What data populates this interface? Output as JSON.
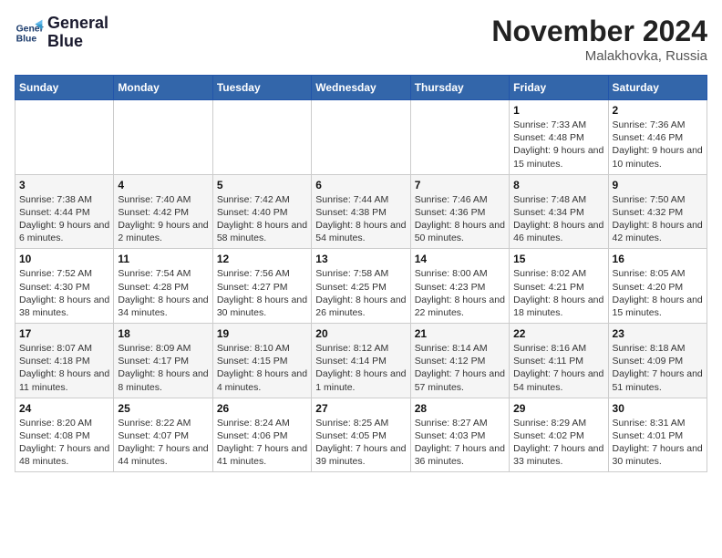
{
  "header": {
    "logo_line1": "General",
    "logo_line2": "Blue",
    "month": "November 2024",
    "location": "Malakhovka, Russia"
  },
  "weekdays": [
    "Sunday",
    "Monday",
    "Tuesday",
    "Wednesday",
    "Thursday",
    "Friday",
    "Saturday"
  ],
  "weeks": [
    [
      {
        "day": "",
        "info": ""
      },
      {
        "day": "",
        "info": ""
      },
      {
        "day": "",
        "info": ""
      },
      {
        "day": "",
        "info": ""
      },
      {
        "day": "",
        "info": ""
      },
      {
        "day": "1",
        "info": "Sunrise: 7:33 AM\nSunset: 4:48 PM\nDaylight: 9 hours and 15 minutes."
      },
      {
        "day": "2",
        "info": "Sunrise: 7:36 AM\nSunset: 4:46 PM\nDaylight: 9 hours and 10 minutes."
      }
    ],
    [
      {
        "day": "3",
        "info": "Sunrise: 7:38 AM\nSunset: 4:44 PM\nDaylight: 9 hours and 6 minutes."
      },
      {
        "day": "4",
        "info": "Sunrise: 7:40 AM\nSunset: 4:42 PM\nDaylight: 9 hours and 2 minutes."
      },
      {
        "day": "5",
        "info": "Sunrise: 7:42 AM\nSunset: 4:40 PM\nDaylight: 8 hours and 58 minutes."
      },
      {
        "day": "6",
        "info": "Sunrise: 7:44 AM\nSunset: 4:38 PM\nDaylight: 8 hours and 54 minutes."
      },
      {
        "day": "7",
        "info": "Sunrise: 7:46 AM\nSunset: 4:36 PM\nDaylight: 8 hours and 50 minutes."
      },
      {
        "day": "8",
        "info": "Sunrise: 7:48 AM\nSunset: 4:34 PM\nDaylight: 8 hours and 46 minutes."
      },
      {
        "day": "9",
        "info": "Sunrise: 7:50 AM\nSunset: 4:32 PM\nDaylight: 8 hours and 42 minutes."
      }
    ],
    [
      {
        "day": "10",
        "info": "Sunrise: 7:52 AM\nSunset: 4:30 PM\nDaylight: 8 hours and 38 minutes."
      },
      {
        "day": "11",
        "info": "Sunrise: 7:54 AM\nSunset: 4:28 PM\nDaylight: 8 hours and 34 minutes."
      },
      {
        "day": "12",
        "info": "Sunrise: 7:56 AM\nSunset: 4:27 PM\nDaylight: 8 hours and 30 minutes."
      },
      {
        "day": "13",
        "info": "Sunrise: 7:58 AM\nSunset: 4:25 PM\nDaylight: 8 hours and 26 minutes."
      },
      {
        "day": "14",
        "info": "Sunrise: 8:00 AM\nSunset: 4:23 PM\nDaylight: 8 hours and 22 minutes."
      },
      {
        "day": "15",
        "info": "Sunrise: 8:02 AM\nSunset: 4:21 PM\nDaylight: 8 hours and 18 minutes."
      },
      {
        "day": "16",
        "info": "Sunrise: 8:05 AM\nSunset: 4:20 PM\nDaylight: 8 hours and 15 minutes."
      }
    ],
    [
      {
        "day": "17",
        "info": "Sunrise: 8:07 AM\nSunset: 4:18 PM\nDaylight: 8 hours and 11 minutes."
      },
      {
        "day": "18",
        "info": "Sunrise: 8:09 AM\nSunset: 4:17 PM\nDaylight: 8 hours and 8 minutes."
      },
      {
        "day": "19",
        "info": "Sunrise: 8:10 AM\nSunset: 4:15 PM\nDaylight: 8 hours and 4 minutes."
      },
      {
        "day": "20",
        "info": "Sunrise: 8:12 AM\nSunset: 4:14 PM\nDaylight: 8 hours and 1 minute."
      },
      {
        "day": "21",
        "info": "Sunrise: 8:14 AM\nSunset: 4:12 PM\nDaylight: 7 hours and 57 minutes."
      },
      {
        "day": "22",
        "info": "Sunrise: 8:16 AM\nSunset: 4:11 PM\nDaylight: 7 hours and 54 minutes."
      },
      {
        "day": "23",
        "info": "Sunrise: 8:18 AM\nSunset: 4:09 PM\nDaylight: 7 hours and 51 minutes."
      }
    ],
    [
      {
        "day": "24",
        "info": "Sunrise: 8:20 AM\nSunset: 4:08 PM\nDaylight: 7 hours and 48 minutes."
      },
      {
        "day": "25",
        "info": "Sunrise: 8:22 AM\nSunset: 4:07 PM\nDaylight: 7 hours and 44 minutes."
      },
      {
        "day": "26",
        "info": "Sunrise: 8:24 AM\nSunset: 4:06 PM\nDaylight: 7 hours and 41 minutes."
      },
      {
        "day": "27",
        "info": "Sunrise: 8:25 AM\nSunset: 4:05 PM\nDaylight: 7 hours and 39 minutes."
      },
      {
        "day": "28",
        "info": "Sunrise: 8:27 AM\nSunset: 4:03 PM\nDaylight: 7 hours and 36 minutes."
      },
      {
        "day": "29",
        "info": "Sunrise: 8:29 AM\nSunset: 4:02 PM\nDaylight: 7 hours and 33 minutes."
      },
      {
        "day": "30",
        "info": "Sunrise: 8:31 AM\nSunset: 4:01 PM\nDaylight: 7 hours and 30 minutes."
      }
    ]
  ]
}
